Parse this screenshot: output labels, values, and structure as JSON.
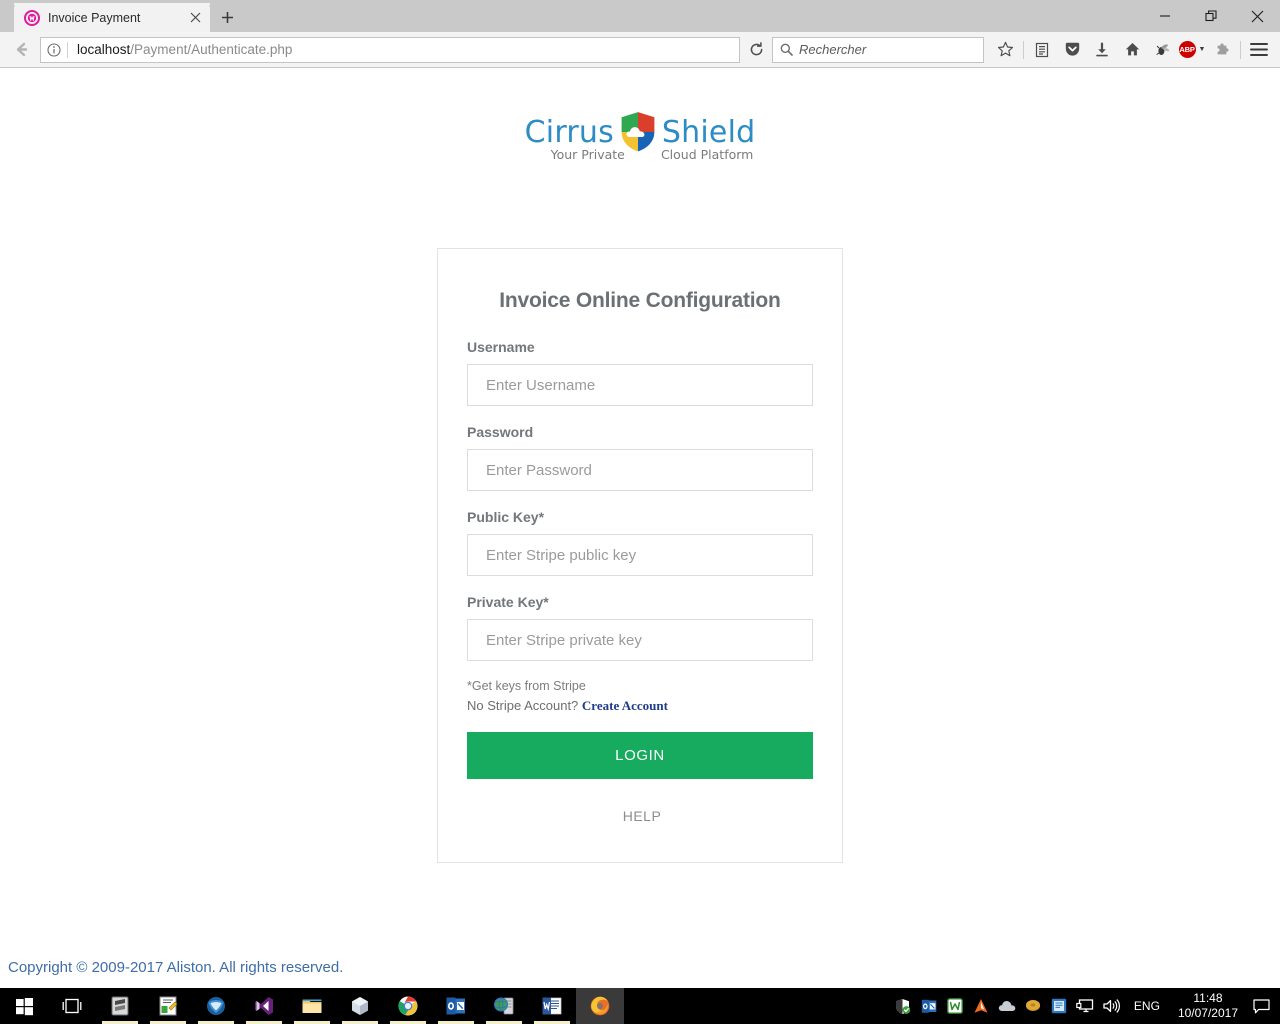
{
  "browser": {
    "tab": {
      "title": "Invoice Payment",
      "favicon_icon": "wamp-favicon",
      "close_icon": "close-icon"
    },
    "new_tab_icon": "plus-icon",
    "window_controls": {
      "minimize_icon": "minimize-icon",
      "restore_icon": "restore-icon",
      "close_icon": "close-icon"
    },
    "nav": {
      "back_icon": "back-arrow-icon",
      "info_icon": "info-circle-icon",
      "reload_icon": "reload-icon",
      "url_host": "localhost",
      "url_path": "/Payment/Authenticate.php"
    },
    "search": {
      "placeholder": "Rechercher",
      "icon": "search-icon"
    },
    "toolbar_icons": [
      {
        "name": "bookmark-star-icon",
        "label": "star"
      },
      {
        "name": "reader-list-icon",
        "label": "library"
      },
      {
        "name": "pocket-icon",
        "label": "pocket"
      },
      {
        "name": "downloads-icon",
        "label": "downloads"
      },
      {
        "name": "home-icon",
        "label": "home"
      },
      {
        "name": "bug-icon",
        "label": "addon"
      },
      {
        "name": "adblock-plus-icon",
        "label": "ABP"
      },
      {
        "name": "extension-icon",
        "label": "extension"
      },
      {
        "name": "hamburger-menu-icon",
        "label": "menu"
      }
    ],
    "abp_label": "ABP"
  },
  "page": {
    "logo": {
      "word_left": "Cirrus",
      "word_right": "Shield",
      "tagline_left": "Your Private",
      "tagline_right": "Cloud Platform",
      "shield_icon": "cirrus-shield-logo-icon",
      "brand_color": "#2d8cc4",
      "shield_colors": {
        "top_left": "#2fa84f",
        "top_right": "#d93f2b",
        "bottom_left": "#f2c230",
        "bottom_right": "#1763b5"
      }
    },
    "card": {
      "title": "Invoice Online Configuration",
      "fields": [
        {
          "label": "Username",
          "placeholder": "Enter Username",
          "value": "",
          "type": "text",
          "name": "username"
        },
        {
          "label": "Password",
          "placeholder": "Enter Password",
          "value": "",
          "type": "password",
          "name": "password"
        },
        {
          "label": "Public Key*",
          "placeholder": "Enter Stripe public key",
          "value": "",
          "type": "text",
          "name": "public-key"
        },
        {
          "label": "Private Key*",
          "placeholder": "Enter Stripe private key",
          "value": "",
          "type": "text",
          "name": "private-key"
        }
      ],
      "note": "*Get keys from Stripe",
      "note_prefix": "No Stripe Account?",
      "create_account_link": "Create Account",
      "login_label": "LOGIN",
      "login_color": "#16ab5f",
      "help_label": "HELP"
    },
    "copyright": "Copyright © 2009-2017 Aliston. All rights reserved.",
    "copyright_color": "#3e6da8"
  },
  "taskbar": {
    "items": [
      {
        "name": "start-button",
        "icon": "windows-logo-icon"
      },
      {
        "name": "task-view-button",
        "icon": "task-view-icon"
      },
      {
        "name": "sublime-text-button",
        "icon": "sublime-text-icon"
      },
      {
        "name": "notepadpp-button",
        "icon": "notepad-plus-plus-icon"
      },
      {
        "name": "thunderbird-button",
        "icon": "thunderbird-icon"
      },
      {
        "name": "visual-studio-button",
        "icon": "visual-studio-icon"
      },
      {
        "name": "file-explorer-button",
        "icon": "file-explorer-icon"
      },
      {
        "name": "package-app-button",
        "icon": "cube-icon"
      },
      {
        "name": "chrome-button",
        "icon": "chrome-icon"
      },
      {
        "name": "outlook-button",
        "icon": "outlook-icon"
      },
      {
        "name": "server-app-button",
        "icon": "server-globe-icon"
      },
      {
        "name": "word-button",
        "icon": "word-icon"
      },
      {
        "name": "firefox-button",
        "icon": "firefox-icon"
      }
    ],
    "tray": [
      {
        "name": "windows-defender-icon"
      },
      {
        "name": "outlook-tray-icon"
      },
      {
        "name": "wamp-server-icon"
      },
      {
        "name": "avast-icon"
      },
      {
        "name": "onedrive-icon"
      },
      {
        "name": "disc-icon"
      },
      {
        "name": "network-config-icon"
      },
      {
        "name": "display-icon"
      },
      {
        "name": "volume-icon"
      }
    ],
    "language": "ENG",
    "time": "11:48",
    "date": "10/07/2017",
    "action_center_icon": "notification-icon"
  }
}
